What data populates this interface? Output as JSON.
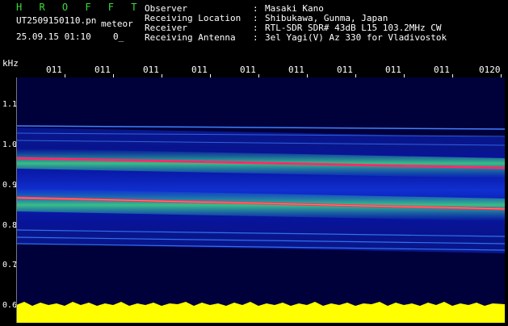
{
  "app": {
    "title": "H R O F F T"
  },
  "file": {
    "name": "UT2509150110.pn",
    "tag": "0_"
  },
  "meteor_label": "meteor",
  "timestamp": "25.09.15 01:10",
  "info": [
    {
      "label": "Observer",
      "value": "Masaki Kano"
    },
    {
      "label": "Receiving Location",
      "value": "Shibukawa, Gunma, Japan"
    },
    {
      "label": "Receiver",
      "value": "RTL-SDR SDR# 43dB L15 103.2MHz CW"
    },
    {
      "label": "Receiving Antenna",
      "value": "3el Yagi(V) Az 330 for Vladivostok"
    }
  ],
  "separator": ":",
  "axis": {
    "y_unit": "kHz",
    "y_ticks": [
      "1.1",
      "1.0",
      "0.9",
      "0.8",
      "0.7",
      "0.6"
    ],
    "x_ticks": [
      "011",
      "011",
      "011",
      "011",
      "011",
      "011",
      "011",
      "011",
      "011",
      "0120"
    ]
  },
  "colors": {
    "background": "#000000",
    "header_accent": "#3cdc3c",
    "spectrogram_bg": "#00003a",
    "echo_line": "#ff2a6a",
    "amplitude": "#ffff00"
  }
}
